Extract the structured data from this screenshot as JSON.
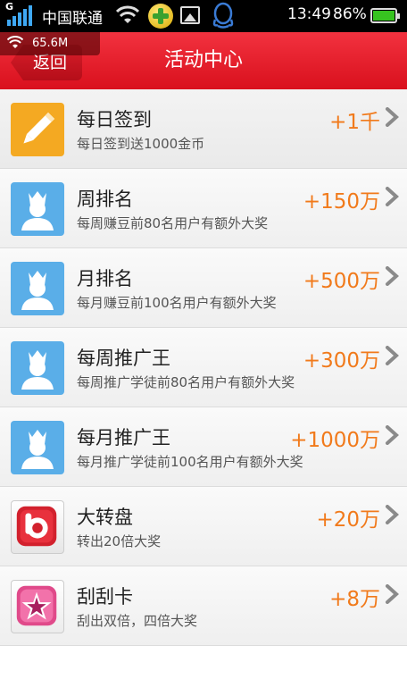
{
  "status_bar": {
    "network_type": "G",
    "carrier": "中国联通",
    "time": "13:49",
    "battery_percent": "86%",
    "battery_level": 0.86
  },
  "network_overlay": {
    "speed": "65.6M"
  },
  "header": {
    "back_label": "返回",
    "title": "活动中心",
    "accent_color": "#e3202c"
  },
  "activities": [
    {
      "title": "每日签到",
      "desc": "每日签到送1000金币",
      "reward": "+1千",
      "icon": "pencil-icon"
    },
    {
      "title": "周排名",
      "desc": "每周赚豆前80名用户有额外大奖",
      "reward": "+150万",
      "icon": "user-crown-icon"
    },
    {
      "title": "月排名",
      "desc": "每月赚豆前100名用户有额外大奖",
      "reward": "+500万",
      "icon": "user-crown-icon"
    },
    {
      "title": "每周推广王",
      "desc": "每周推广学徒前80名用户有额外大奖",
      "reward": "+300万",
      "icon": "user-crown-icon"
    },
    {
      "title": "每月推广王",
      "desc": "每月推广学徒前100名用户有额外大奖",
      "reward": "+1000万",
      "icon": "user-crown-icon"
    },
    {
      "title": "大转盘",
      "desc": "转出20倍大奖",
      "reward": "+20万",
      "icon": "wheel-icon"
    },
    {
      "title": "刮刮卡",
      "desc": "刮出双倍，四倍大奖",
      "reward": "+8万",
      "icon": "star-card-icon"
    }
  ],
  "colors": {
    "reward": "#f17a1b",
    "header": "#e3202c"
  }
}
